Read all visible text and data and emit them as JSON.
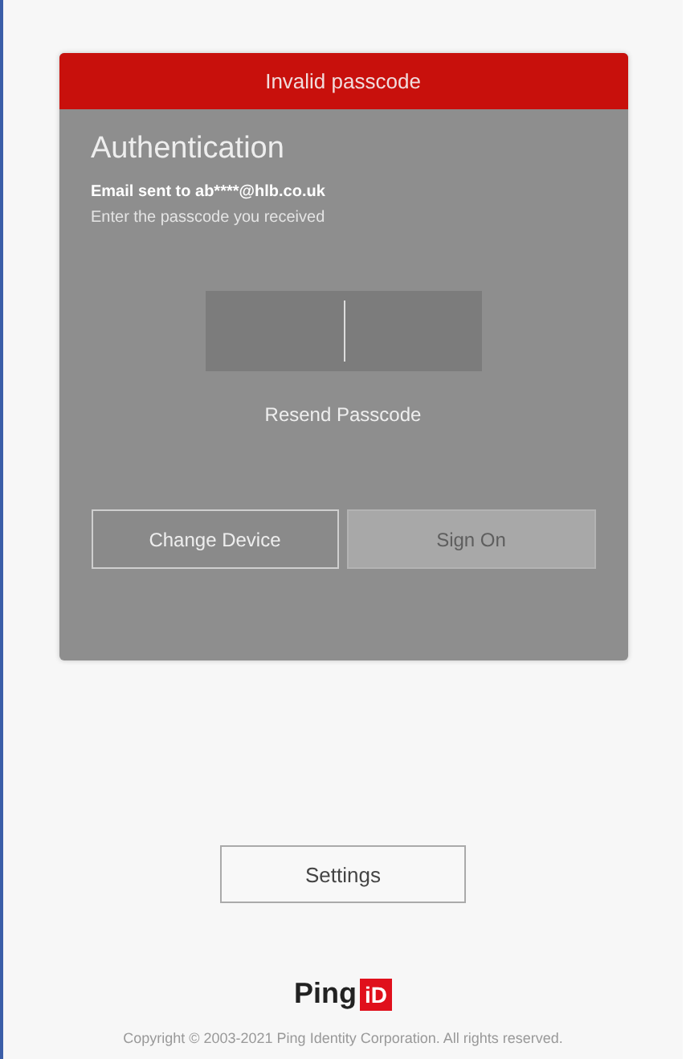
{
  "error_banner": "Invalid passcode",
  "title": "Authentication",
  "email_line": "Email sent to ab****@hlb.co.uk",
  "instruction": "Enter the passcode you received",
  "passcode_field": {
    "focused": true
  },
  "resend_link": "Resend Passcode",
  "buttons": [
    {
      "label": "Change Device",
      "disabled": false
    },
    {
      "label": "Sign On",
      "disabled": true
    }
  ],
  "settings_button": "Settings",
  "logo": {
    "word": "Ping",
    "badge": "iD"
  },
  "copyright": "Copyright © 2003-2021 Ping Identity Corporation. All rights reserved."
}
